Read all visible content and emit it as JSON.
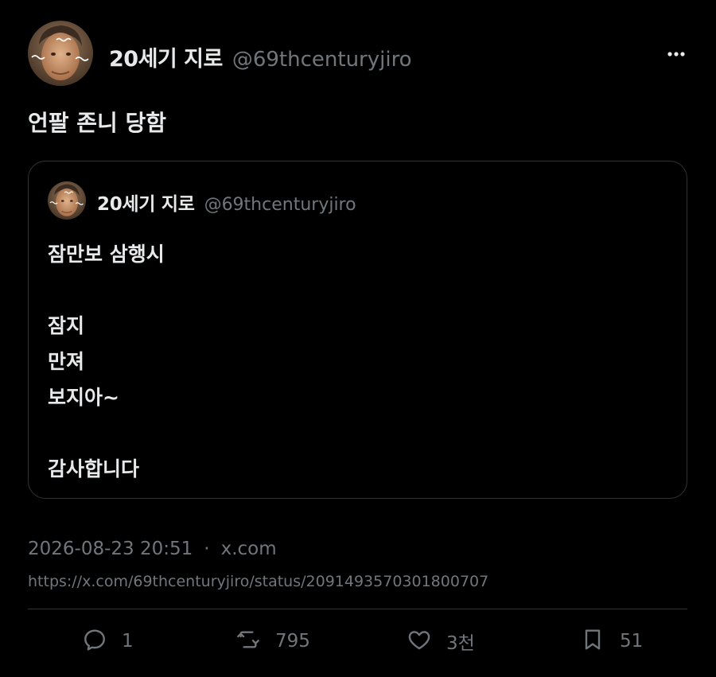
{
  "tweet": {
    "author_name": "20세기 지로",
    "author_handle": "@69thcenturyjiro",
    "text": "언팔 존니 당함",
    "timestamp": "2026-08-23 20:51",
    "separator": "·",
    "source": "x.com",
    "url": "https://x.com/69thcenturyjiro/status/2091493570301800707",
    "menu_icon": "more-horizontal-icon"
  },
  "quoted_tweet": {
    "author_name": "20세기 지로",
    "author_handle": "@69thcenturyjiro",
    "lines": [
      "잠만보 삼행시",
      "",
      "잠지",
      "만져",
      "보지아~",
      "",
      "감사합니다"
    ]
  },
  "actions": {
    "reply": {
      "count": "1",
      "icon": "reply-icon"
    },
    "retweet": {
      "count": "795",
      "icon": "retweet-icon"
    },
    "like": {
      "count": "3천",
      "icon": "heart-icon"
    },
    "bookmark": {
      "count": "51",
      "icon": "bookmark-icon"
    }
  },
  "colors": {
    "background": "#000000",
    "text_primary": "#e7e9ea",
    "text_secondary": "#71767b",
    "border": "#2f3336"
  }
}
